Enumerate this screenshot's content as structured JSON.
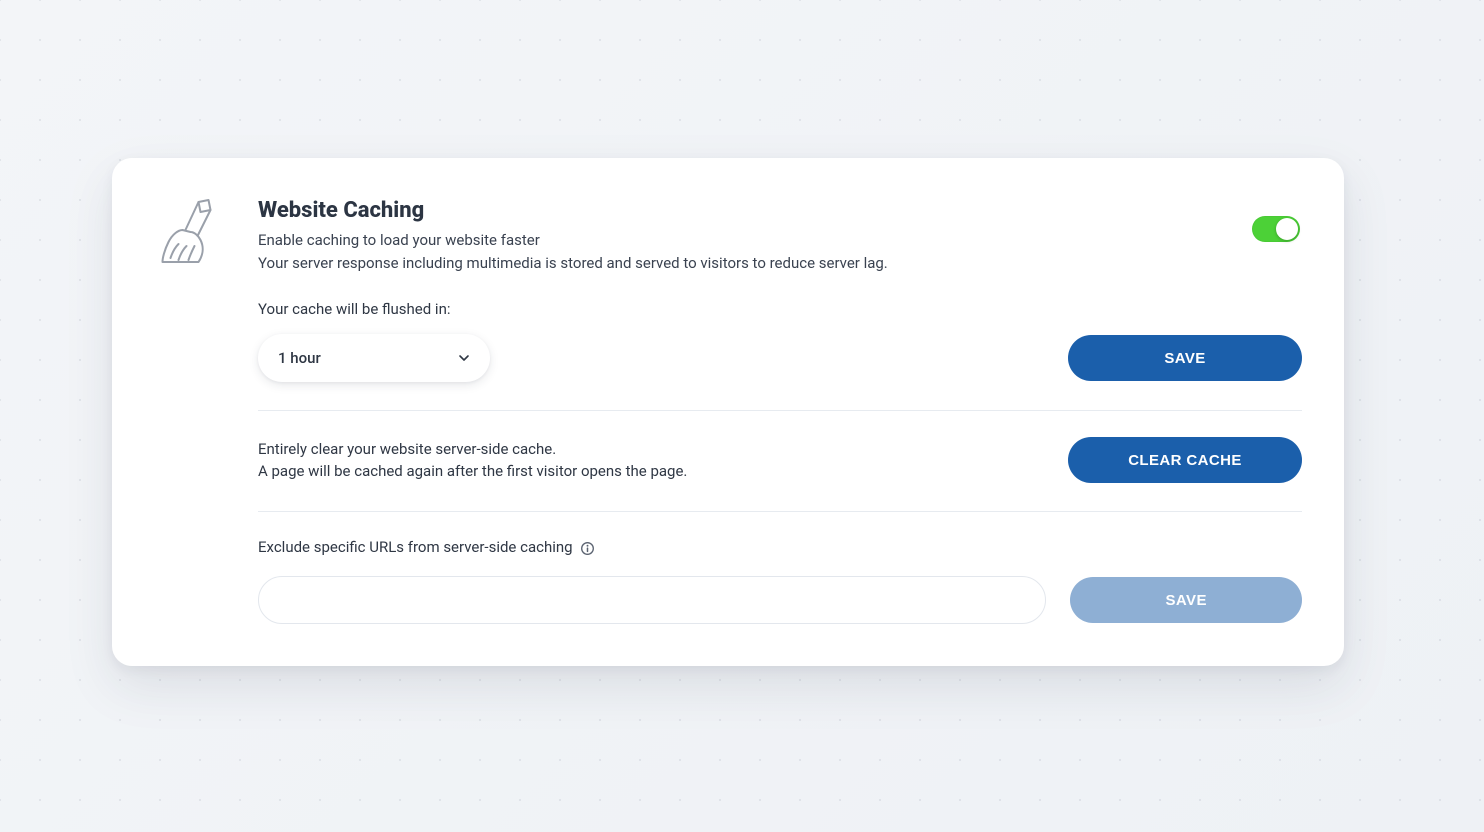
{
  "card": {
    "title": "Website Caching",
    "subtitle_line1": "Enable caching to load your website faster",
    "subtitle_line2": "Your server response including multimedia is stored and served to visitors to reduce server lag.",
    "toggle_on": true
  },
  "flush": {
    "label": "Your cache will be flushed in:",
    "selected": "1 hour",
    "save_label": "SAVE"
  },
  "clear": {
    "line1": "Entirely clear your website server-side cache.",
    "line2": "A page will be cached again after the first visitor opens the page.",
    "button_label": "CLEAR CACHE"
  },
  "exclude": {
    "label": "Exclude specific URLs from server-side caching",
    "input_value": "",
    "input_placeholder": "",
    "save_label": "SAVE"
  },
  "colors": {
    "primary": "#1b5fab",
    "disabled": "#8eafd4",
    "toggle_on": "#4cd137",
    "text": "#2f3744"
  }
}
